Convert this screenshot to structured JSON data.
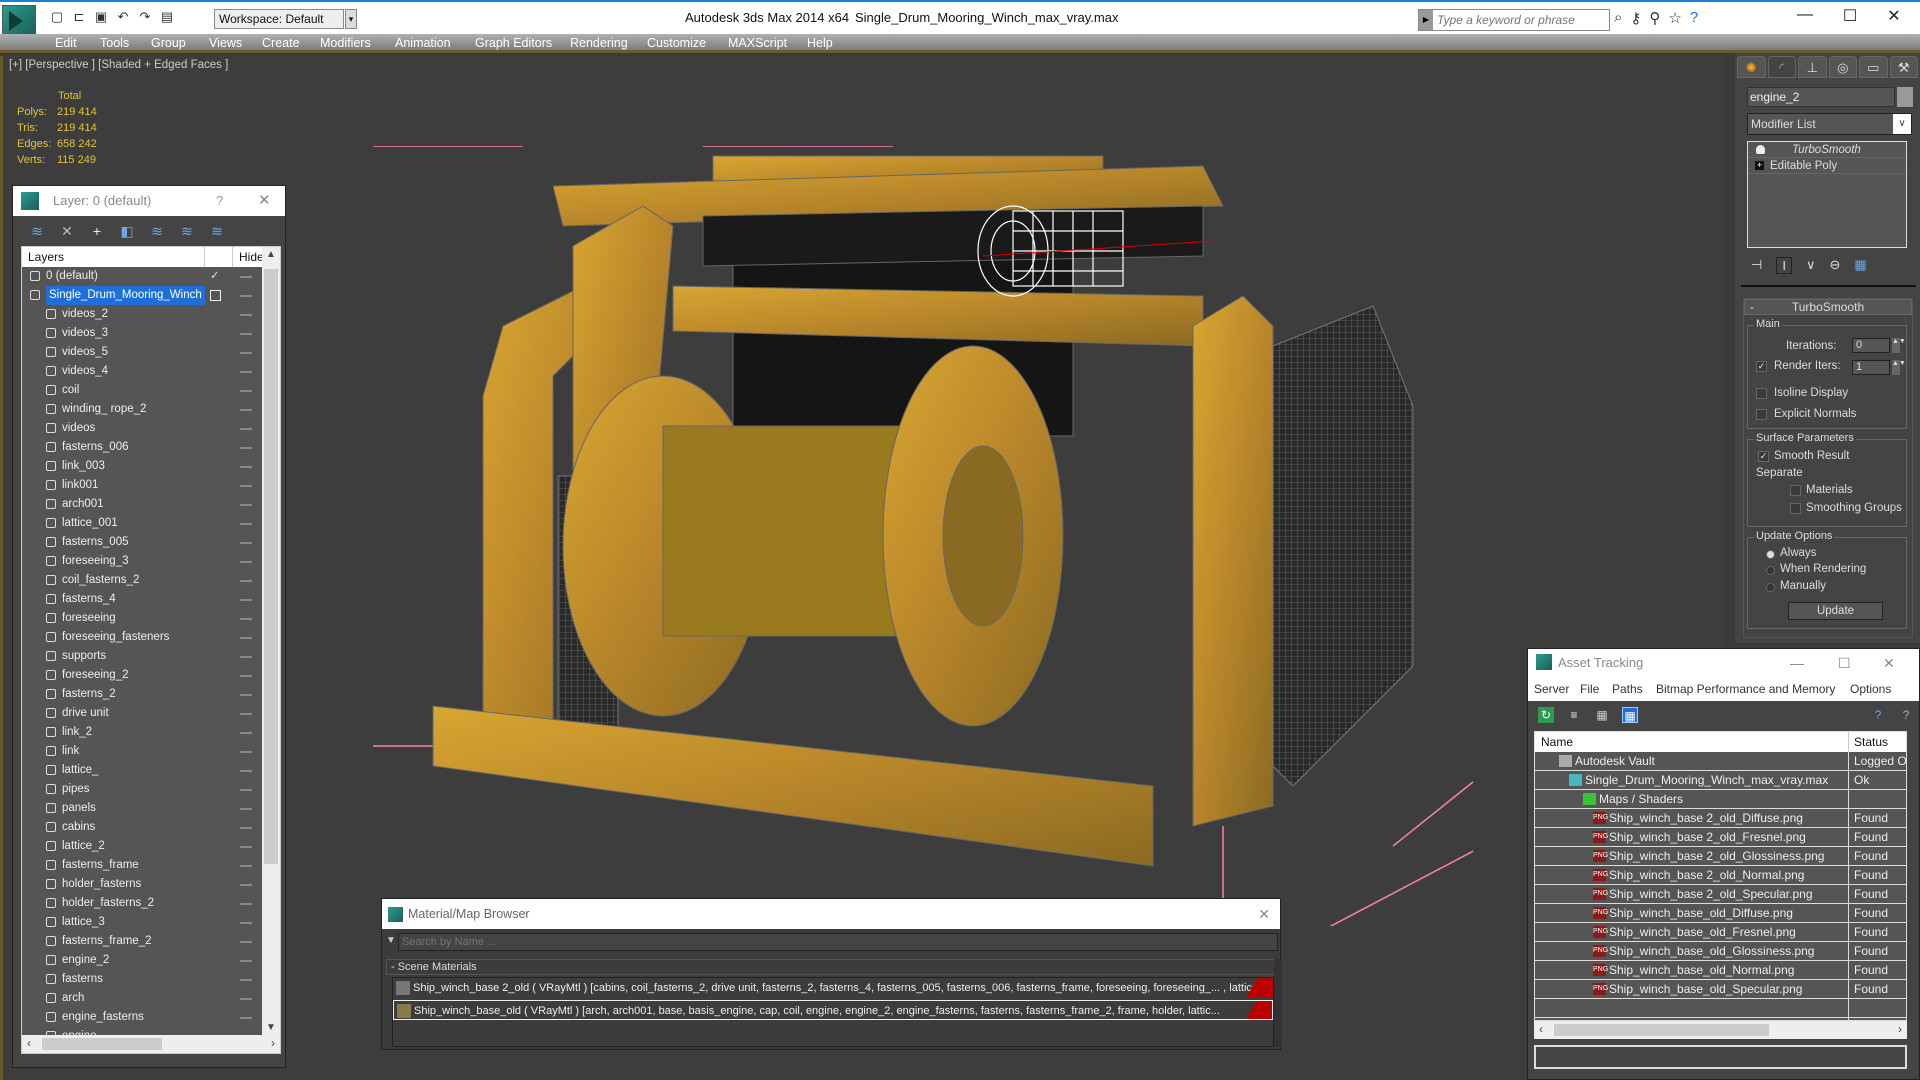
{
  "titlebar": {
    "app_title": "Autodesk 3ds Max  2014 x64",
    "file_title": "Single_Drum_Mooring_Winch_max_vray.max",
    "workspace": "Workspace: Default",
    "search_placeholder": "Type a keyword or phrase"
  },
  "menu": [
    "Edit",
    "Tools",
    "Group",
    "Views",
    "Create",
    "Modifiers",
    "Animation",
    "Graph Editors",
    "Rendering",
    "Customize",
    "MAXScript",
    "Help"
  ],
  "viewport": {
    "label": "[+] [Perspective ] [Shaded + Edged Faces ]",
    "stats": {
      "header": "Total",
      "rows": [
        {
          "k": "Polys:",
          "v": "219 414"
        },
        {
          "k": "Tris:",
          "v": "219 414"
        },
        {
          "k": "Edges:",
          "v": "658 242"
        },
        {
          "k": "Verts:",
          "v": "115 249"
        }
      ]
    }
  },
  "layer_panel": {
    "title": "Layer: 0 (default)",
    "help": "?",
    "col_layers": "Layers",
    "col_hide": "Hide",
    "top_layers": [
      {
        "name": "0 (default)",
        "checked": true
      },
      {
        "name": "Single_Drum_Mooring_Winch",
        "selected": true
      }
    ],
    "objects": [
      "videos_2",
      "videos_3",
      "videos_5",
      "videos_4",
      "coil",
      "winding_ rope_2",
      "videos",
      "fasterns_006",
      "link_003",
      "link001",
      "arch001",
      "lattice_001",
      "fasterns_005",
      "foreseeing_3",
      "coil_fasterns_2",
      "fasterns_4",
      "foreseeing",
      "foreseeing_fasteners",
      "supports",
      "foreseeing_2",
      "fasterns_2",
      "drive unit",
      "link_2",
      "link",
      "lattice_",
      "pipes",
      "panels",
      "cabins",
      "lattice_2",
      "fasterns_frame",
      "holder_fasterns",
      "holder_fasterns_2",
      "lattice_3",
      "fasterns_frame_2",
      "engine_2",
      "fasterns",
      "arch",
      "engine_fasterns",
      "engine"
    ]
  },
  "command_panel": {
    "object_name": "engine_2",
    "modifier_list": "Modifier List",
    "stack": [
      {
        "name": "TurboSmooth",
        "italic": true
      },
      {
        "name": "Editable Poly",
        "italic": false
      }
    ],
    "rollout_title": "TurboSmooth",
    "main_group": "Main",
    "iterations_label": "Iterations:",
    "iterations_value": "0",
    "render_iters_label": "Render Iters:",
    "render_iters_value": "1",
    "render_iters_checked": true,
    "isoline_display": "Isoline Display",
    "explicit_normals": "Explicit Normals",
    "surface_group": "Surface Parameters",
    "smooth_result": "Smooth Result",
    "separate": "Separate",
    "materials": "Materials",
    "smoothing_groups": "Smoothing Groups",
    "update_group": "Update Options",
    "update_options": [
      "Always",
      "When Rendering",
      "Manually"
    ],
    "update_selected": "Always",
    "update_button": "Update"
  },
  "asset_tracking": {
    "title": "Asset Tracking",
    "menu": [
      "Server",
      "File",
      "Paths",
      "Bitmap Performance and Memory",
      "Options"
    ],
    "col_name": "Name",
    "col_status": "Status",
    "rows": [
      {
        "name": "Autodesk Vault",
        "status": "Logged O",
        "level": 1,
        "icon": "vault-icon"
      },
      {
        "name": "Single_Drum_Mooring_Winch_max_vray.max",
        "status": "Ok",
        "level": 2,
        "icon": "max-file-icon"
      },
      {
        "name": "Maps / Shaders",
        "status": "",
        "level": 3,
        "icon": "maps-icon"
      },
      {
        "name": "Ship_winch_base 2_old_Diffuse.png",
        "status": "Found",
        "level": 4,
        "icon": "png-icon"
      },
      {
        "name": "Ship_winch_base 2_old_Fresnel.png",
        "status": "Found",
        "level": 4,
        "icon": "png-icon"
      },
      {
        "name": "Ship_winch_base 2_old_Glossiness.png",
        "status": "Found",
        "level": 4,
        "icon": "png-icon"
      },
      {
        "name": "Ship_winch_base 2_old_Normal.png",
        "status": "Found",
        "level": 4,
        "icon": "png-icon"
      },
      {
        "name": "Ship_winch_base 2_old_Specular.png",
        "status": "Found",
        "level": 4,
        "icon": "png-icon"
      },
      {
        "name": "Ship_winch_base_old_Diffuse.png",
        "status": "Found",
        "level": 4,
        "icon": "png-icon"
      },
      {
        "name": "Ship_winch_base_old_Fresnel.png",
        "status": "Found",
        "level": 4,
        "icon": "png-icon"
      },
      {
        "name": "Ship_winch_base_old_Glossiness.png",
        "status": "Found",
        "level": 4,
        "icon": "png-icon"
      },
      {
        "name": "Ship_winch_base_old_Normal.png",
        "status": "Found",
        "level": 4,
        "icon": "png-icon"
      },
      {
        "name": "Ship_winch_base_old_Specular.png",
        "status": "Found",
        "level": 4,
        "icon": "png-icon"
      }
    ]
  },
  "material_browser": {
    "title": "Material/Map Browser",
    "search_placeholder": "Search by Name ...",
    "section": "- Scene Materials",
    "materials": [
      {
        "text": "Ship_winch_base 2_old  ( VRayMtl ) [cabins, coil_fasterns_2, drive unit, fasterns_2, fasterns_4, fasterns_005, fasterns_006, fasterns_frame, foreseeing, foreseeing_... , lattice"
      },
      {
        "text": "Ship_winch_base_old  ( VRayMtl ) [arch, arch001, base, basis_engine, cap, coil, engine, engine_2, engine_fasterns, fasterns, fasterns_frame_2, frame, holder, lattic..."
      }
    ]
  },
  "colors": {
    "accent": "#1e6fd9",
    "stats_text": "#e4c23a",
    "viewport_bg": "#3d3d3d",
    "winch_yellow": "#c8972a",
    "bbox_pink": "#ff7fb0"
  }
}
